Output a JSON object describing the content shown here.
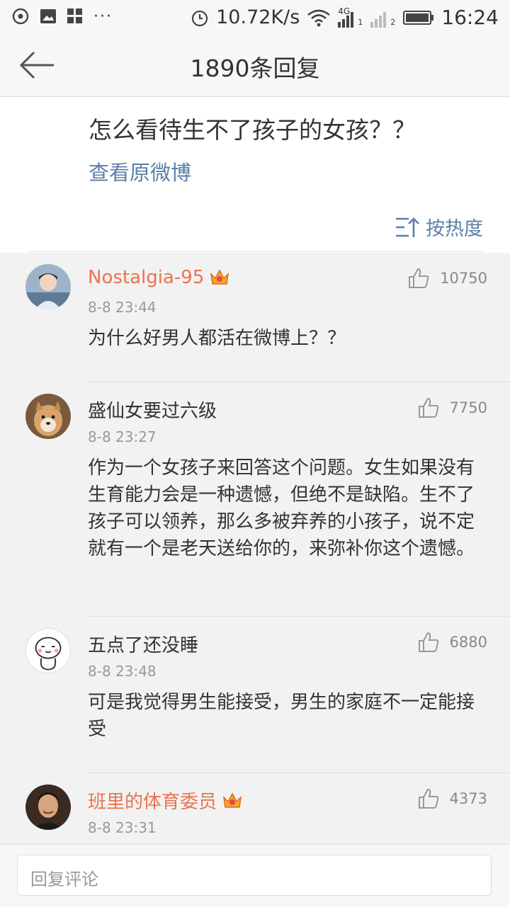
{
  "status_bar": {
    "net_speed": "10.72K/s",
    "network_type": "4G",
    "sim1": "1",
    "sim2": "2",
    "time": "16:24"
  },
  "header": {
    "title": "1890条回复"
  },
  "original_post": {
    "text": "怎么看待生不了孩子的女孩？？",
    "view_link": "查看原微博",
    "sort_label": "按热度"
  },
  "comments": [
    {
      "username": "Nostalgia-95",
      "vip": true,
      "time": "8-8 23:44",
      "likes": "10750",
      "text": "为什么好男人都活在微博上？？"
    },
    {
      "username": "盛仙女要过六级",
      "vip": false,
      "time": "8-8 23:27",
      "likes": "7750",
      "text": "作为一个女孩子来回答这个问题。女生如果没有生育能力会是一种遗憾，但绝不是缺陷。生不了孩子可以领养，那么多被弃养的小孩子，说不定就有一个是老天送给你的，来弥补你这个遗憾。"
    },
    {
      "username": "五点了还没睡",
      "vip": false,
      "time": "8-8 23:48",
      "likes": "6880",
      "text": "可是我觉得男生能接受，男生的家庭不一定能接受"
    },
    {
      "username": "班里的体育委员",
      "vip": true,
      "time": "8-8 23:31",
      "likes": "4373",
      "text": ""
    }
  ],
  "reply_bar": {
    "placeholder": "回复评论"
  },
  "colors": {
    "vip_name": "#eb7350",
    "link": "#5b7fa6",
    "background": "#f2f2f2"
  }
}
